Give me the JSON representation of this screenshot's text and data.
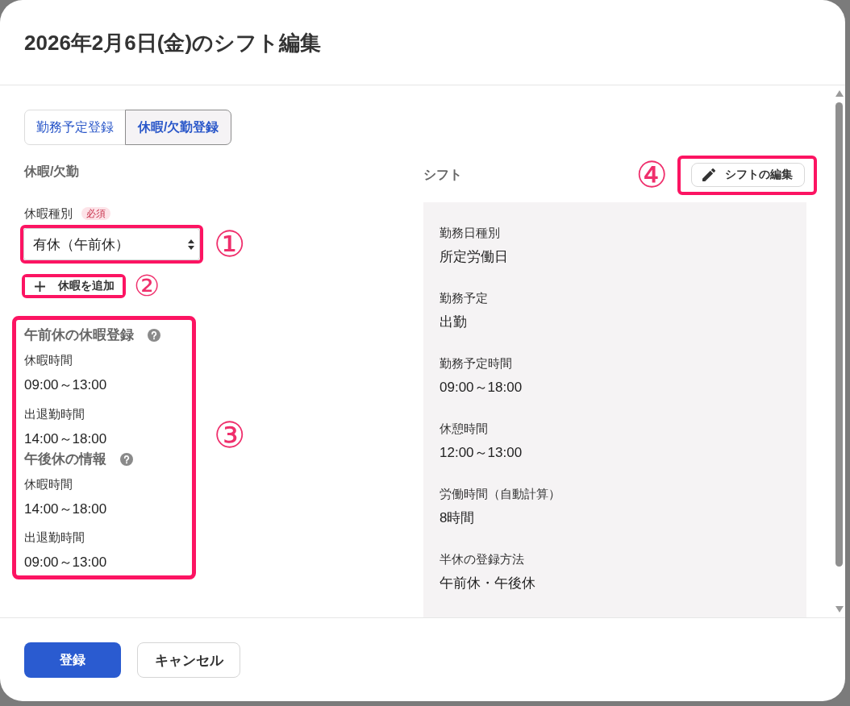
{
  "dialog": {
    "title": "2026年2月6日(金)のシフト編集"
  },
  "tabs": [
    {
      "label": "勤務予定登録",
      "selected": false
    },
    {
      "label": "休暇/欠勤登録",
      "selected": true
    }
  ],
  "leave": {
    "heading": "休暇/欠勤",
    "leave_type": {
      "label": "休暇種別",
      "badge": "必須",
      "value": "有休（午前休）",
      "callout": "①"
    },
    "add_button": {
      "label": "休暇を追加",
      "callout": "②"
    },
    "details": {
      "callout": "③",
      "groups": [
        {
          "title": "午前休の休暇登録",
          "rows": [
            {
              "label": "休暇時間",
              "value": "09:00～13:00"
            },
            {
              "label": "出退勤時間",
              "value": "14:00～18:00"
            }
          ]
        },
        {
          "title": "午後休の情報",
          "rows": [
            {
              "label": "休暇時間",
              "value": "14:00～18:00"
            },
            {
              "label": "出退勤時間",
              "value": "09:00～13:00"
            }
          ]
        }
      ]
    }
  },
  "shift": {
    "heading": "シフト",
    "edit_button": {
      "label": "シフトの編集",
      "callout": "④"
    },
    "fields": [
      {
        "label": "勤務日種別",
        "value": "所定労働日"
      },
      {
        "label": "勤務予定",
        "value": "出勤"
      },
      {
        "label": "勤務予定時間",
        "value": "09:00～18:00"
      },
      {
        "label": "休憩時間",
        "value": "12:00～13:00"
      },
      {
        "label": "労働時間（自動計算）",
        "value": "8時間"
      },
      {
        "label": "半休の登録方法",
        "value": "午前休・午後休"
      }
    ]
  },
  "footer": {
    "buttons": [
      {
        "label": "登録",
        "kind": "primary"
      },
      {
        "label": "キャンセル",
        "kind": "secondary"
      }
    ]
  }
}
